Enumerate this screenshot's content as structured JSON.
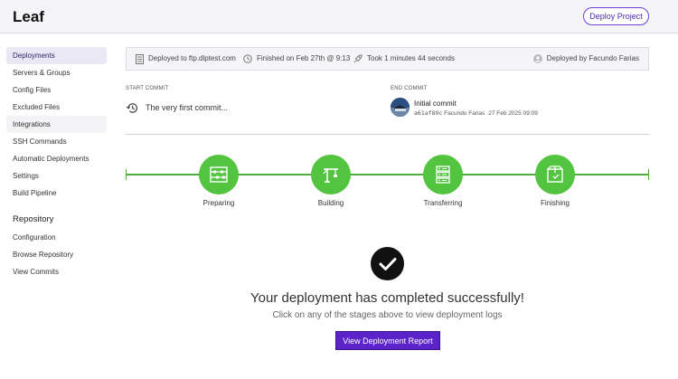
{
  "app": {
    "brand": "Leaf",
    "deploy_button": "Deploy Project"
  },
  "sidebar": {
    "items": [
      {
        "label": "Deployments"
      },
      {
        "label": "Servers & Groups"
      },
      {
        "label": "Config Files"
      },
      {
        "label": "Excluded Files"
      },
      {
        "label": "Integrations"
      },
      {
        "label": "SSH Commands"
      },
      {
        "label": "Automatic Deployments"
      },
      {
        "label": "Settings"
      },
      {
        "label": "Build Pipeline"
      }
    ],
    "repository_heading": "Repository",
    "repo_items": [
      {
        "label": "Configuration"
      },
      {
        "label": "Browse Repository"
      },
      {
        "label": "View Commits"
      }
    ]
  },
  "info": {
    "deployed_to": "Deployed to ftp.dlptest.com",
    "finished": "Finished on Feb 27th @ 9:13",
    "took": "Took 1 minutes 44 seconds",
    "deployed_by": "Deployed by Facundo Farias"
  },
  "commits": {
    "start_label": "START COMMIT",
    "start_message": "The very first commit...",
    "end_label": "END COMMIT",
    "end_title": "Initial commit",
    "end_hash": "a61af89c",
    "end_author": "Facundo Farias",
    "end_date": "·27 Feb 2025 09:09"
  },
  "stages": [
    {
      "label": "Preparing",
      "icon": "abacus-icon"
    },
    {
      "label": "Building",
      "icon": "crane-icon"
    },
    {
      "label": "Transferring",
      "icon": "server-transfer-icon"
    },
    {
      "label": "Finishing",
      "icon": "package-icon"
    }
  ],
  "result": {
    "title": "Your deployment has completed successfully!",
    "subtitle": "Click on any of the stages above to view deployment logs",
    "report_button": "View Deployment Report"
  },
  "colors": {
    "accent": "#5b23c9",
    "success": "#53c43f",
    "line": "#4caf39"
  }
}
